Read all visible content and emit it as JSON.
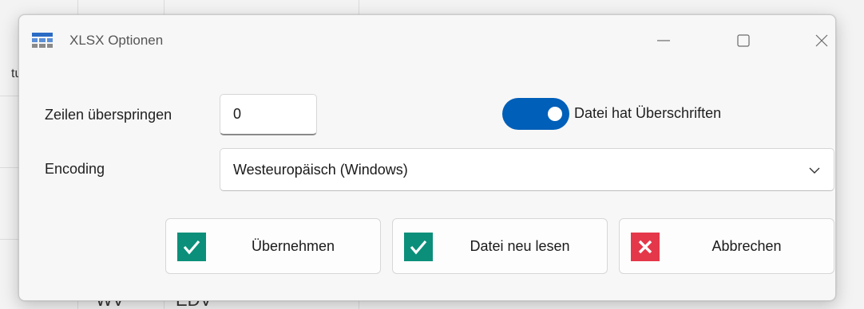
{
  "background": {
    "side_fragment": "tu",
    "bottom_fragment_1": "WV",
    "bottom_fragment_2": "EDV"
  },
  "dialog": {
    "title": "XLSX Optionen",
    "icons": {
      "app": "table-icon",
      "minimize": "minimize-icon",
      "maximize": "maximize-icon",
      "close": "close-icon"
    }
  },
  "form": {
    "skip_rows": {
      "label": "Zeilen überspringen",
      "value": "0"
    },
    "has_headers": {
      "label": "Datei hat Überschriften",
      "checked": true,
      "accent": "#005fb8"
    },
    "encoding": {
      "label": "Encoding",
      "value": "Westeuropäisch (Windows)"
    }
  },
  "buttons": {
    "apply": {
      "label": "Übernehmen",
      "icon": "checkmark-icon",
      "color": "#0b8f7a"
    },
    "reload": {
      "label": "Datei neu lesen",
      "icon": "checkmark-icon",
      "color": "#0b8f7a"
    },
    "cancel": {
      "label": "Abbrechen",
      "icon": "cross-icon",
      "color": "#e5374a"
    }
  }
}
